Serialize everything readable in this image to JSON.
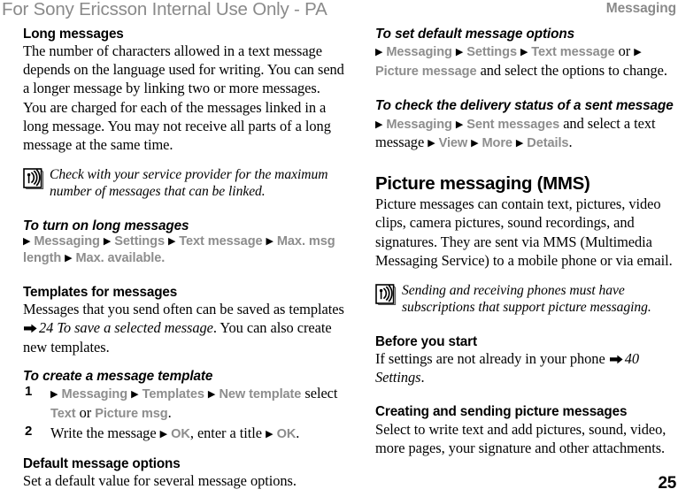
{
  "header": {
    "watermark": "For Sony Ericsson Internal Use Only - PA",
    "running_head": "Messaging"
  },
  "footer": {
    "page_number": "25"
  },
  "icons": {
    "note": "antenna-signal-icon",
    "cross_reference": "right-arrow-icon",
    "path_separator": "right-triangle-icon"
  },
  "colors": {
    "watermark_grey": "#8a8a8a",
    "ui_term_grey": "#8d8d8d",
    "body_black": "#000000",
    "page_background": "#ffffff"
  },
  "left_column": {
    "s1": {
      "heading": "Long messages",
      "body": "The number of characters allowed in a text message depends on the language used for writing. You can send a longer message by linking two or more messages. You are charged for each of the messages linked in a long message. You may not receive all parts of a long message at the same time."
    },
    "note1": {
      "text": "Check with your service provider for the maximum number of messages that can be linked."
    },
    "s2": {
      "heading": "To turn on long messages",
      "path": [
        "Messaging",
        "Settings",
        "Text message",
        "Max. msg length",
        "Max. available"
      ],
      "trailing": "."
    },
    "s3": {
      "heading": "Templates for messages",
      "body_a": "Messages that you send often can be saved as templates ",
      "xref": "24 To save a selected message",
      "body_b": ". You can also create new templates."
    },
    "s4": {
      "heading": "To create a message template",
      "steps": [
        {
          "num": "1",
          "parts": [
            {
              "t": "tri"
            },
            {
              "t": "ui",
              "v": "Messaging"
            },
            {
              "t": "tri"
            },
            {
              "t": "ui",
              "v": "Templates"
            },
            {
              "t": "tri"
            },
            {
              "t": "ui",
              "v": "New template"
            },
            {
              "t": "ser",
              "v": " select "
            },
            {
              "t": "ui",
              "v": "Text"
            },
            {
              "t": "ser",
              "v": " or "
            },
            {
              "t": "ui",
              "v": "Picture msg"
            },
            {
              "t": "ser",
              "v": "."
            }
          ]
        },
        {
          "num": "2",
          "parts": [
            {
              "t": "ser",
              "v": "Write the message "
            },
            {
              "t": "tri"
            },
            {
              "t": "ui",
              "v": "OK"
            },
            {
              "t": "ser",
              "v": ", enter a title "
            },
            {
              "t": "tri"
            },
            {
              "t": "ui",
              "v": "OK"
            },
            {
              "t": "ser",
              "v": "."
            }
          ]
        }
      ]
    },
    "s5": {
      "heading": "Default message options",
      "body": "Set a default value for several message options."
    }
  },
  "right_column": {
    "s1": {
      "heading": "To set default message options",
      "parts": [
        {
          "t": "tri"
        },
        {
          "t": "ui",
          "v": "Messaging"
        },
        {
          "t": "tri"
        },
        {
          "t": "ui",
          "v": "Settings"
        },
        {
          "t": "tri"
        },
        {
          "t": "ui",
          "v": "Text message"
        },
        {
          "t": "ser",
          "v": " or "
        },
        {
          "t": "tri"
        },
        {
          "t": "ui",
          "v": "Picture message"
        },
        {
          "t": "ser",
          "v": " and select the options to change."
        }
      ]
    },
    "s2": {
      "heading": "To check the delivery status of a sent message",
      "parts": [
        {
          "t": "tri"
        },
        {
          "t": "ui",
          "v": "Messaging"
        },
        {
          "t": "tri"
        },
        {
          "t": "ui",
          "v": "Sent messages"
        },
        {
          "t": "ser",
          "v": " and select a text message "
        },
        {
          "t": "tri"
        },
        {
          "t": "ui",
          "v": "View"
        },
        {
          "t": "tri"
        },
        {
          "t": "ui",
          "v": "More"
        },
        {
          "t": "tri"
        },
        {
          "t": "ui",
          "v": "Details"
        },
        {
          "t": "ser",
          "v": "."
        }
      ]
    },
    "s3": {
      "heading": "Picture messaging (MMS)",
      "body": "Picture messages can contain text, pictures, video clips, camera pictures, sound recordings, and signatures. They are sent via MMS (Multimedia Messaging Service) to a mobile phone or via email."
    },
    "note1": {
      "text": "Sending and receiving phones must have subscriptions that support picture messaging."
    },
    "s4": {
      "heading": "Before you start",
      "body_a": "If settings are not already in your phone ",
      "xref": "40 Settings",
      "body_b": "."
    },
    "s5": {
      "heading": "Creating and sending picture messages",
      "body": "Select to write text and add pictures, sound, video, more pages, your signature and other attachments."
    }
  }
}
